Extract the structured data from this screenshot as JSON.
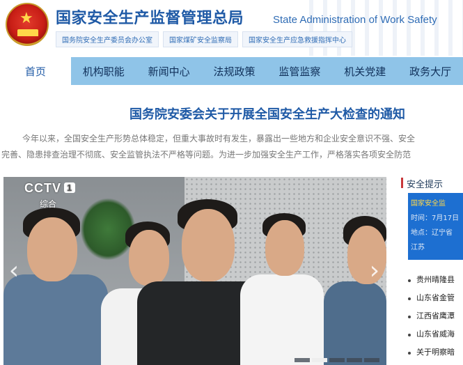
{
  "header": {
    "title_cn": "国家安全生产监督管理总局",
    "title_en": "State Administration of Work Safety",
    "sub_links": [
      "国务院安全生产委员会办公室",
      "国家煤矿安全监察局",
      "国家安全生产应急救援指挥中心"
    ]
  },
  "nav": {
    "items": [
      "首页",
      "机构职能",
      "新闻中心",
      "法规政策",
      "监管监察",
      "机关党建",
      "政务大厅"
    ]
  },
  "article": {
    "headline": "国务院安委会关于开展全国安全生产大检查的通知",
    "para1": "今年以来，全国安全生产形势总体稳定，但重大事故时有发生，暴露出一些地方和企业安全意识不强、安全",
    "para2": "完善、隐患排查治理不彻底、安全监管执法不严格等问题。为进一步加强安全生产工作，严格落实各项安全防范"
  },
  "video": {
    "channel": "CCTV",
    "channel_num": "1",
    "channel_sub": "综合",
    "active_dot": 1
  },
  "side": {
    "title": "安全提示",
    "box_lines": [
      "国家安全监",
      "时间：7月17日",
      "地点：辽宁省",
      "江苏"
    ],
    "items": [
      "贵州晴隆县",
      "山东省金管",
      "江西省鹰潭",
      "山东省威海",
      "关于明察暗"
    ]
  },
  "colors": {
    "brand_blue": "#1f5aa6",
    "nav_bg": "#8fc4e8",
    "side_box": "#1d6fd1"
  }
}
